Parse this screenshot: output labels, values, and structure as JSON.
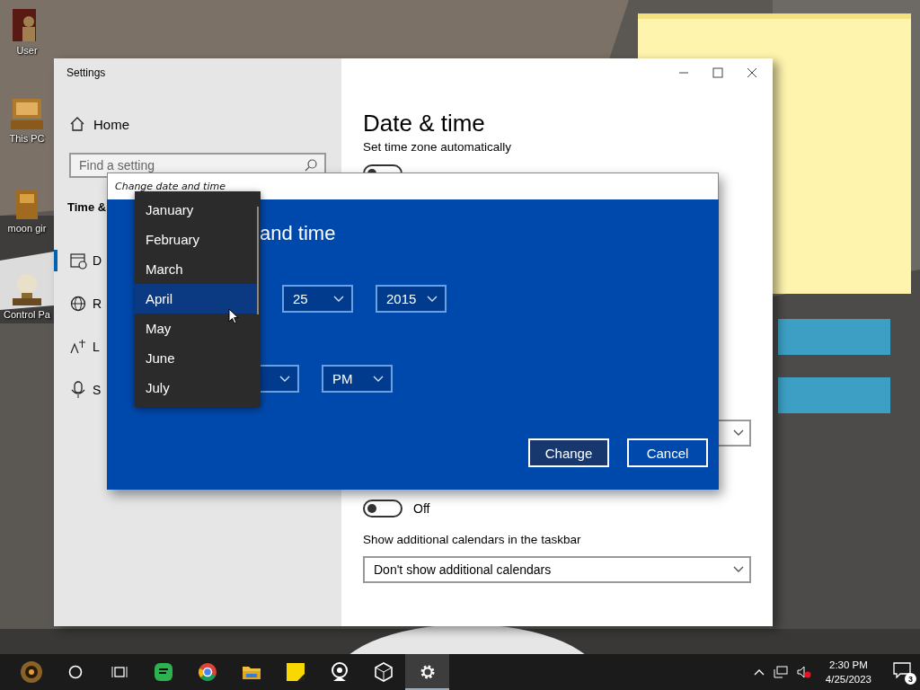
{
  "desktop": {
    "icons": [
      {
        "kind": "user",
        "label": "User"
      },
      {
        "kind": "computer",
        "label": "This PC"
      },
      {
        "kind": "box",
        "label": "moon gir"
      },
      {
        "kind": "bulb",
        "label": "Control Pa"
      }
    ]
  },
  "sticky_note": {
    "kind": "note"
  },
  "settings_window": {
    "title": "Settings",
    "sidebar": {
      "home": "Home",
      "search": {
        "placeholder": "Find a setting"
      },
      "section": "Time &",
      "items": [
        {
          "kind": "calendar",
          "label": "D",
          "selected": true
        },
        {
          "kind": "globe",
          "label": "R",
          "selected": false
        },
        {
          "kind": "language",
          "label": "L",
          "selected": false
        },
        {
          "kind": "mic",
          "label": "S",
          "selected": false
        }
      ]
    },
    "content": {
      "title": "Date & time",
      "items": [
        {
          "kind": "label",
          "text": "Set time zone automatically"
        },
        {
          "kind": "toggle",
          "on": false
        },
        {
          "kind": "dropdown"
        },
        {
          "kind": "toggle",
          "on": false,
          "text": "Off"
        },
        {
          "kind": "label",
          "text": "Show additional calendars in the taskbar"
        },
        {
          "kind": "dropdown",
          "value": "Don't show additional calendars"
        }
      ]
    }
  },
  "dialog": {
    "title": "Change date and time",
    "heading": "and time",
    "date_fields": [
      "25",
      "2015"
    ],
    "time_fields": [
      {
        "kind": "combo"
      },
      {
        "kind": "combo",
        "value": "PM"
      }
    ],
    "buttons": [
      {
        "label": "Change",
        "kind": "primary"
      },
      {
        "label": "Cancel",
        "kind": "secondary"
      }
    ],
    "months": [
      {
        "label": "January",
        "selected": false
      },
      {
        "label": "February",
        "selected": false
      },
      {
        "label": "March",
        "selected": false
      },
      {
        "label": "April",
        "selected": true
      },
      {
        "label": "May",
        "selected": false
      },
      {
        "label": "June",
        "selected": false
      },
      {
        "label": "July",
        "selected": false
      }
    ]
  },
  "taskbar": {
    "buttons": [
      {
        "kind": "start",
        "selected": false
      },
      {
        "kind": "search",
        "selected": false
      },
      {
        "kind": "task_view",
        "selected": false
      },
      {
        "kind": "chat",
        "selected": false
      },
      {
        "kind": "browser",
        "selected": false
      },
      {
        "kind": "folder",
        "selected": false
      },
      {
        "kind": "note",
        "selected": false
      },
      {
        "kind": "webcam",
        "selected": false
      },
      {
        "kind": "cube",
        "selected": false
      },
      {
        "kind": "settings",
        "selected": true
      }
    ],
    "time": "2:30 PM",
    "date": "4/25/2023",
    "notifications": "3"
  }
}
